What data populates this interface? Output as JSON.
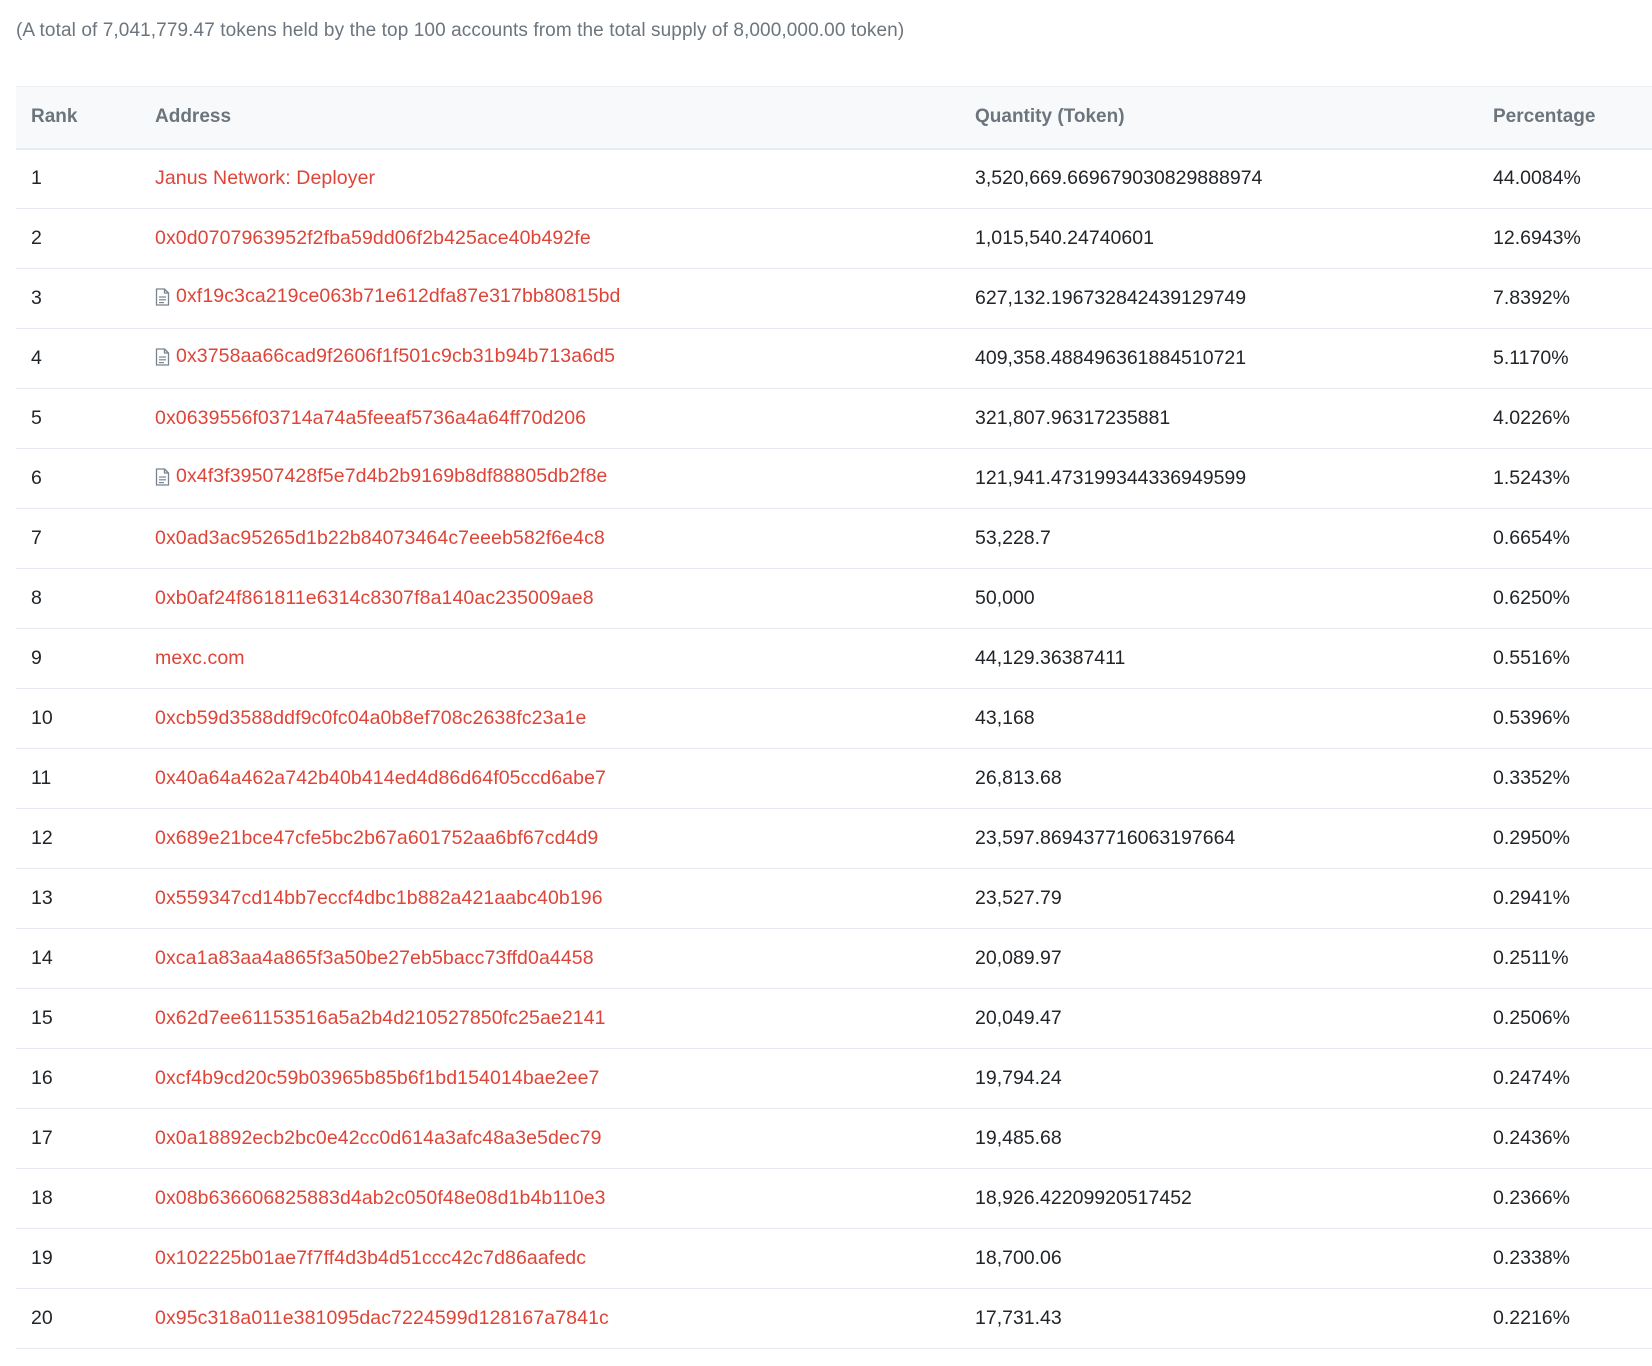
{
  "summary": "(A total of 7,041,779.47 tokens held by the top 100 accounts from the total supply of 8,000,000.00 token)",
  "table": {
    "headers": {
      "rank": "Rank",
      "address": "Address",
      "quantity": "Quantity (Token)",
      "percentage": "Percentage"
    },
    "rows": [
      {
        "rank": "1",
        "address": "Janus Network: Deployer",
        "contract": false,
        "quantity": "3,520,669.669679030829888974",
        "percentage": "44.0084%"
      },
      {
        "rank": "2",
        "address": "0x0d0707963952f2fba59dd06f2b425ace40b492fe",
        "contract": false,
        "quantity": "1,015,540.24740601",
        "percentage": "12.6943%"
      },
      {
        "rank": "3",
        "address": "0xf19c3ca219ce063b71e612dfa87e317bb80815bd",
        "contract": true,
        "quantity": "627,132.196732842439129749",
        "percentage": "7.8392%"
      },
      {
        "rank": "4",
        "address": "0x3758aa66cad9f2606f1f501c9cb31b94b713a6d5",
        "contract": true,
        "quantity": "409,358.488496361884510721",
        "percentage": "5.1170%"
      },
      {
        "rank": "5",
        "address": "0x0639556f03714a74a5feeaf5736a4a64ff70d206",
        "contract": false,
        "quantity": "321,807.96317235881",
        "percentage": "4.0226%"
      },
      {
        "rank": "6",
        "address": "0x4f3f39507428f5e7d4b2b9169b8df88805db2f8e",
        "contract": true,
        "quantity": "121,941.473199344336949599",
        "percentage": "1.5243%"
      },
      {
        "rank": "7",
        "address": "0x0ad3ac95265d1b22b84073464c7eeeb582f6e4c8",
        "contract": false,
        "quantity": "53,228.7",
        "percentage": "0.6654%"
      },
      {
        "rank": "8",
        "address": "0xb0af24f861811e6314c8307f8a140ac235009ae8",
        "contract": false,
        "quantity": "50,000",
        "percentage": "0.6250%"
      },
      {
        "rank": "9",
        "address": "mexc.com",
        "contract": false,
        "quantity": "44,129.36387411",
        "percentage": "0.5516%"
      },
      {
        "rank": "10",
        "address": "0xcb59d3588ddf9c0fc04a0b8ef708c2638fc23a1e",
        "contract": false,
        "quantity": "43,168",
        "percentage": "0.5396%"
      },
      {
        "rank": "11",
        "address": "0x40a64a462a742b40b414ed4d86d64f05ccd6abe7",
        "contract": false,
        "quantity": "26,813.68",
        "percentage": "0.3352%"
      },
      {
        "rank": "12",
        "address": "0x689e21bce47cfe5bc2b67a601752aa6bf67cd4d9",
        "contract": false,
        "quantity": "23,597.869437716063197664",
        "percentage": "0.2950%"
      },
      {
        "rank": "13",
        "address": "0x559347cd14bb7eccf4dbc1b882a421aabc40b196",
        "contract": false,
        "quantity": "23,527.79",
        "percentage": "0.2941%"
      },
      {
        "rank": "14",
        "address": "0xca1a83aa4a865f3a50be27eb5bacc73ffd0a4458",
        "contract": false,
        "quantity": "20,089.97",
        "percentage": "0.2511%"
      },
      {
        "rank": "15",
        "address": "0x62d7ee61153516a5a2b4d210527850fc25ae2141",
        "contract": false,
        "quantity": "20,049.47",
        "percentage": "0.2506%"
      },
      {
        "rank": "16",
        "address": "0xcf4b9cd20c59b03965b85b6f1bd154014bae2ee7",
        "contract": false,
        "quantity": "19,794.24",
        "percentage": "0.2474%"
      },
      {
        "rank": "17",
        "address": "0x0a18892ecb2bc0e42cc0d614a3afc48a3e5dec79",
        "contract": false,
        "quantity": "19,485.68",
        "percentage": "0.2436%"
      },
      {
        "rank": "18",
        "address": "0x08b636606825883d4ab2c050f48e08d1b4b110e3",
        "contract": false,
        "quantity": "18,926.42209920517452",
        "percentage": "0.2366%"
      },
      {
        "rank": "19",
        "address": "0x102225b01ae7f7ff4d3b4d51ccc42c7d86aafedc",
        "contract": false,
        "quantity": "18,700.06",
        "percentage": "0.2338%"
      },
      {
        "rank": "20",
        "address": "0x95c318a011e381095dac7224599d128167a7841c",
        "contract": false,
        "quantity": "17,731.43",
        "percentage": "0.2216%"
      }
    ]
  },
  "colors": {
    "link": "#de4437",
    "muted": "#6c757d",
    "header_bg": "#f8f9fa",
    "border": "#e7eaf3"
  },
  "icons": {
    "contract": "contract-file-icon"
  }
}
